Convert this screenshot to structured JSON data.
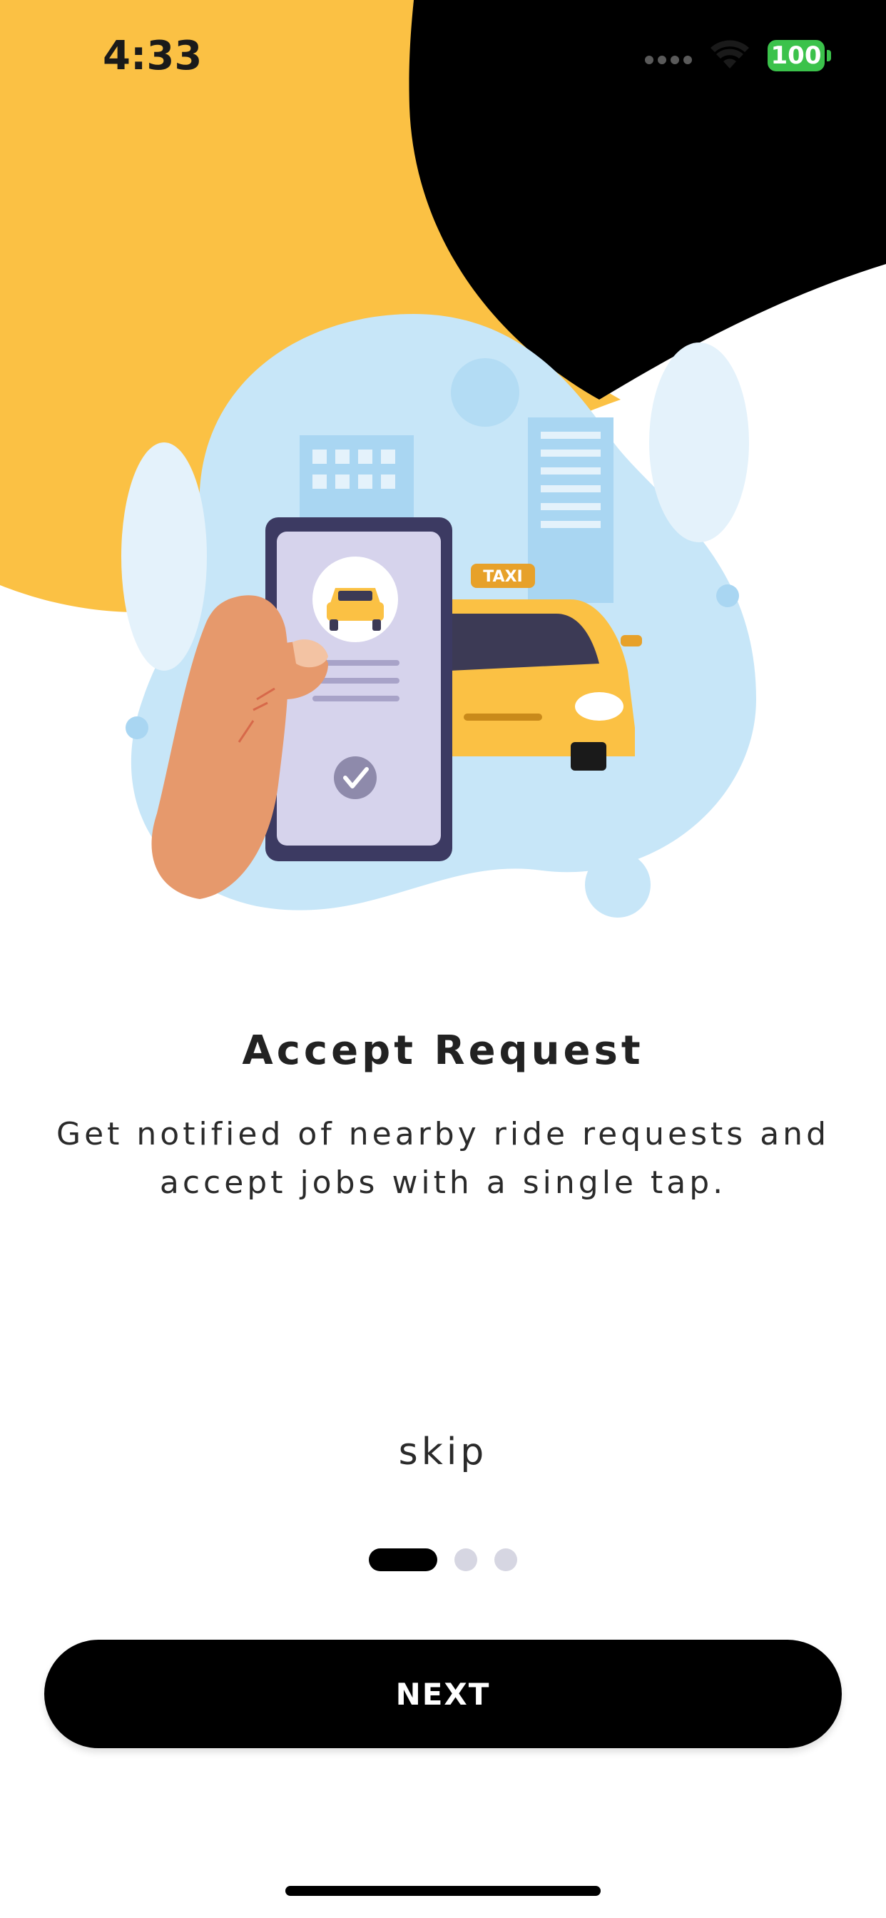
{
  "status_bar": {
    "time": "4:33",
    "battery": "100",
    "icons": [
      "cellular-signal-icon",
      "wifi-icon",
      "battery-icon"
    ]
  },
  "onboarding": {
    "illustration": {
      "description_icon": "taxi-booking-illustration",
      "taxi_sign": "TAXI"
    },
    "title": "Accept Request",
    "subtitle": "Get notified of nearby ride requests and accept jobs with a single tap.",
    "skip_label": "skip",
    "pager": {
      "current": 1,
      "total": 3
    },
    "next_label": "NEXT"
  },
  "colors": {
    "accent_yellow": "#FBC144",
    "black": "#000000",
    "light_blue": "#C7E6F8",
    "battery_green": "#3BC24B"
  }
}
